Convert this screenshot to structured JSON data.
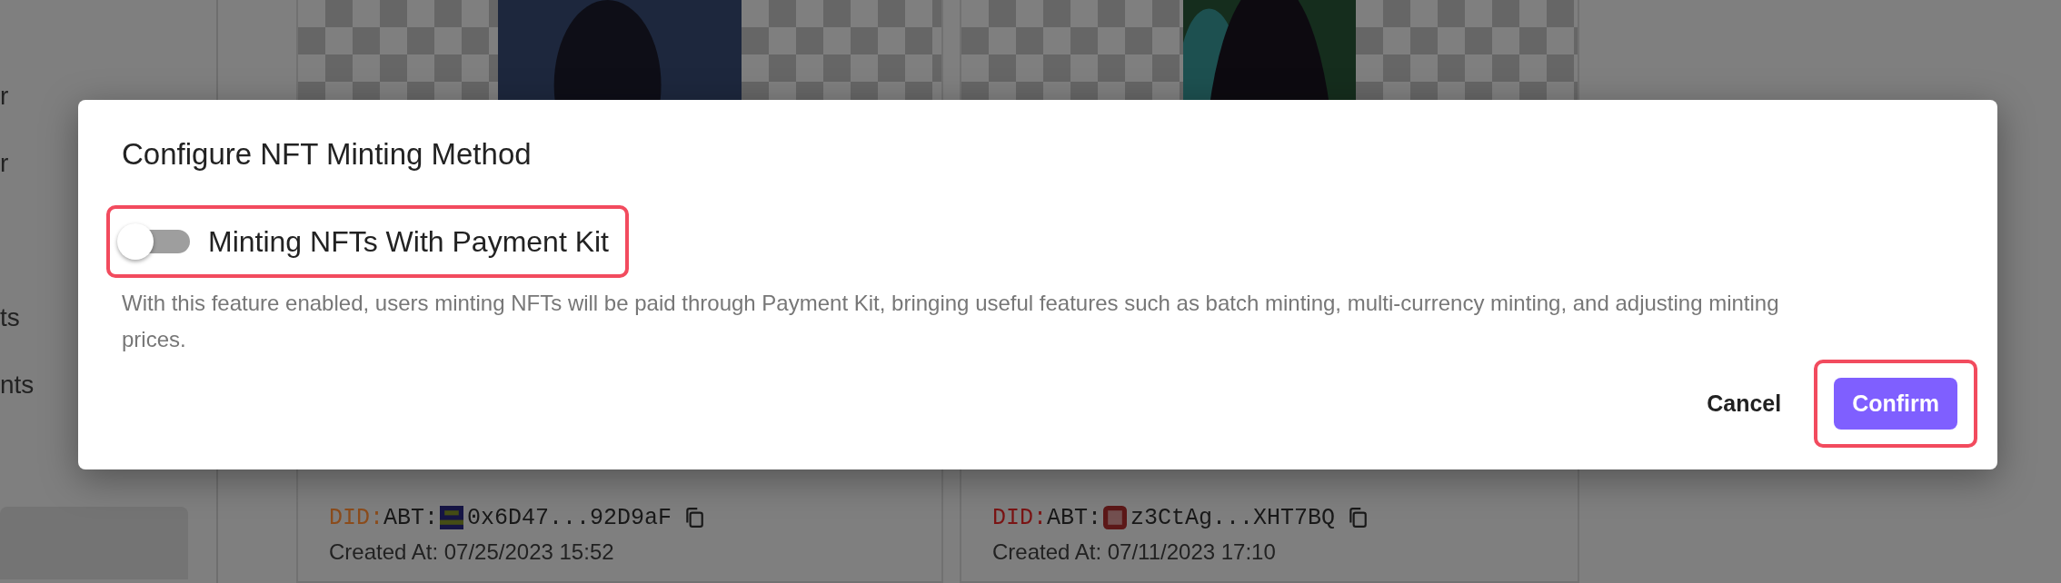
{
  "sidebar": {
    "items": [
      {
        "label": "r",
        "selected": false
      },
      {
        "label": "r",
        "selected": false
      },
      {
        "label": "ts",
        "selected": false
      },
      {
        "label": "nts",
        "selected": false
      },
      {
        "selected": true
      }
    ]
  },
  "cards": [
    {
      "did_label": "DID:",
      "color": "#8b4c1c",
      "did_prefix": "ABT:",
      "did_value": "0x6D47...92D9aF",
      "created": "Created At: 07/25/2023 15:52"
    },
    {
      "did_label": "DID:",
      "color": "#7a1414",
      "did_prefix": "ABT:",
      "did_value": "z3CtAg...XHT7BQ",
      "created": "Created At: 07/11/2023 17:10"
    }
  ],
  "dialog": {
    "title": "Configure NFT Minting Method",
    "toggle": {
      "label": "Minting NFTs With Payment Kit",
      "on": false,
      "highlighted": true
    },
    "description": "With this feature enabled, users minting NFTs will be paid through Payment Kit, bringing useful features such as batch minting, multi-currency minting, and adjusting minting prices.",
    "buttons": [
      {
        "label": "Cancel",
        "kind": "text",
        "highlighted": false
      },
      {
        "label": "Confirm",
        "kind": "primary",
        "highlighted": true
      }
    ]
  }
}
